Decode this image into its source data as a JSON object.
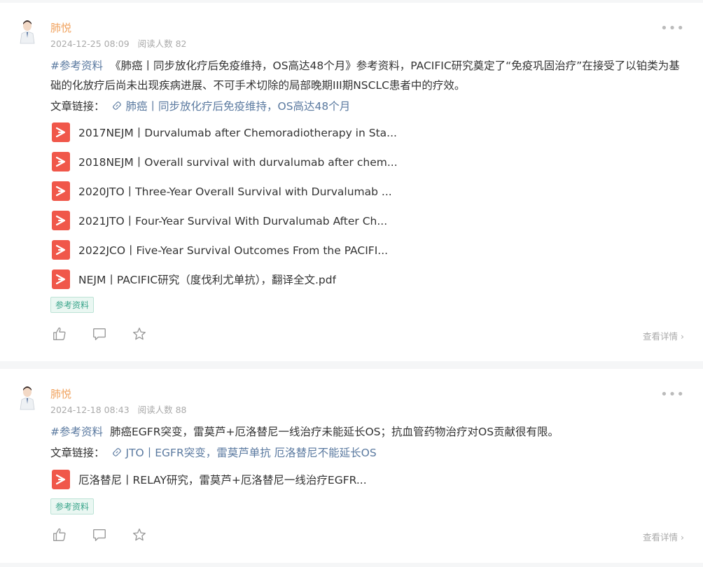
{
  "posts": [
    {
      "author": "肺悦",
      "date": "2024-12-25 08:09",
      "views": "阅读人数 82",
      "hashtag": "#参考资料",
      "text": "《肺癌丨同步放化疗后免疫维持，OS高达48个月》参考资料，PACIFIC研究奠定了“免疫巩固治疗”在接受了以铂类为基础的化放疗后尚未出现疾病进展、不可手术切除的局部晚期III期NSCLC患者中的疗效。",
      "link_label": "文章链接：",
      "link_text": "肺癌丨同步放化疗后免疫维持，OS高达48个月",
      "files": [
        "2017NEJM丨Durvalumab after Chemoradiotherapy in Sta...",
        "2018NEJM丨Overall survival with durvalumab after chem...",
        "2020JTO丨Three-Year Overall Survival with Durvalumab ...",
        "2021JTO丨Four-Year Survival With Durvalumab After Ch...",
        "2022JCO丨Five-Year Survival Outcomes From the PACIFI...",
        "NEJM丨PACIFIC研究（度伐利尤单抗），翻译全文.pdf"
      ],
      "tag": "参考资料",
      "view_detail": "查看详情 ›"
    },
    {
      "author": "肺悦",
      "date": "2024-12-18 08:43",
      "views": "阅读人数 88",
      "hashtag": "#参考资料",
      "text": "肺癌EGFR突变，雷莫芦+厄洛替尼一线治疗未能延长OS；抗血管药物治疗对OS贡献很有限。",
      "link_label": "文章链接：",
      "link_text": "JTO丨EGFR突变，雷莫芦单抗 厄洛替尼不能延长OS",
      "files": [
        "厄洛替尼丨RELAY研究，雷莫芦+厄洛替尼一线治疗EGFR..."
      ],
      "tag": "参考资料",
      "view_detail": "查看详情 ›"
    }
  ],
  "colors": {
    "author": "#f0a15c",
    "link": "#5b7aa0",
    "tag_text": "#3aa58b",
    "pdf": "#f0574a"
  },
  "icons": [
    "avatar",
    "more-icon",
    "link-icon",
    "pdf-icon",
    "like-icon",
    "comment-icon",
    "star-icon"
  ]
}
